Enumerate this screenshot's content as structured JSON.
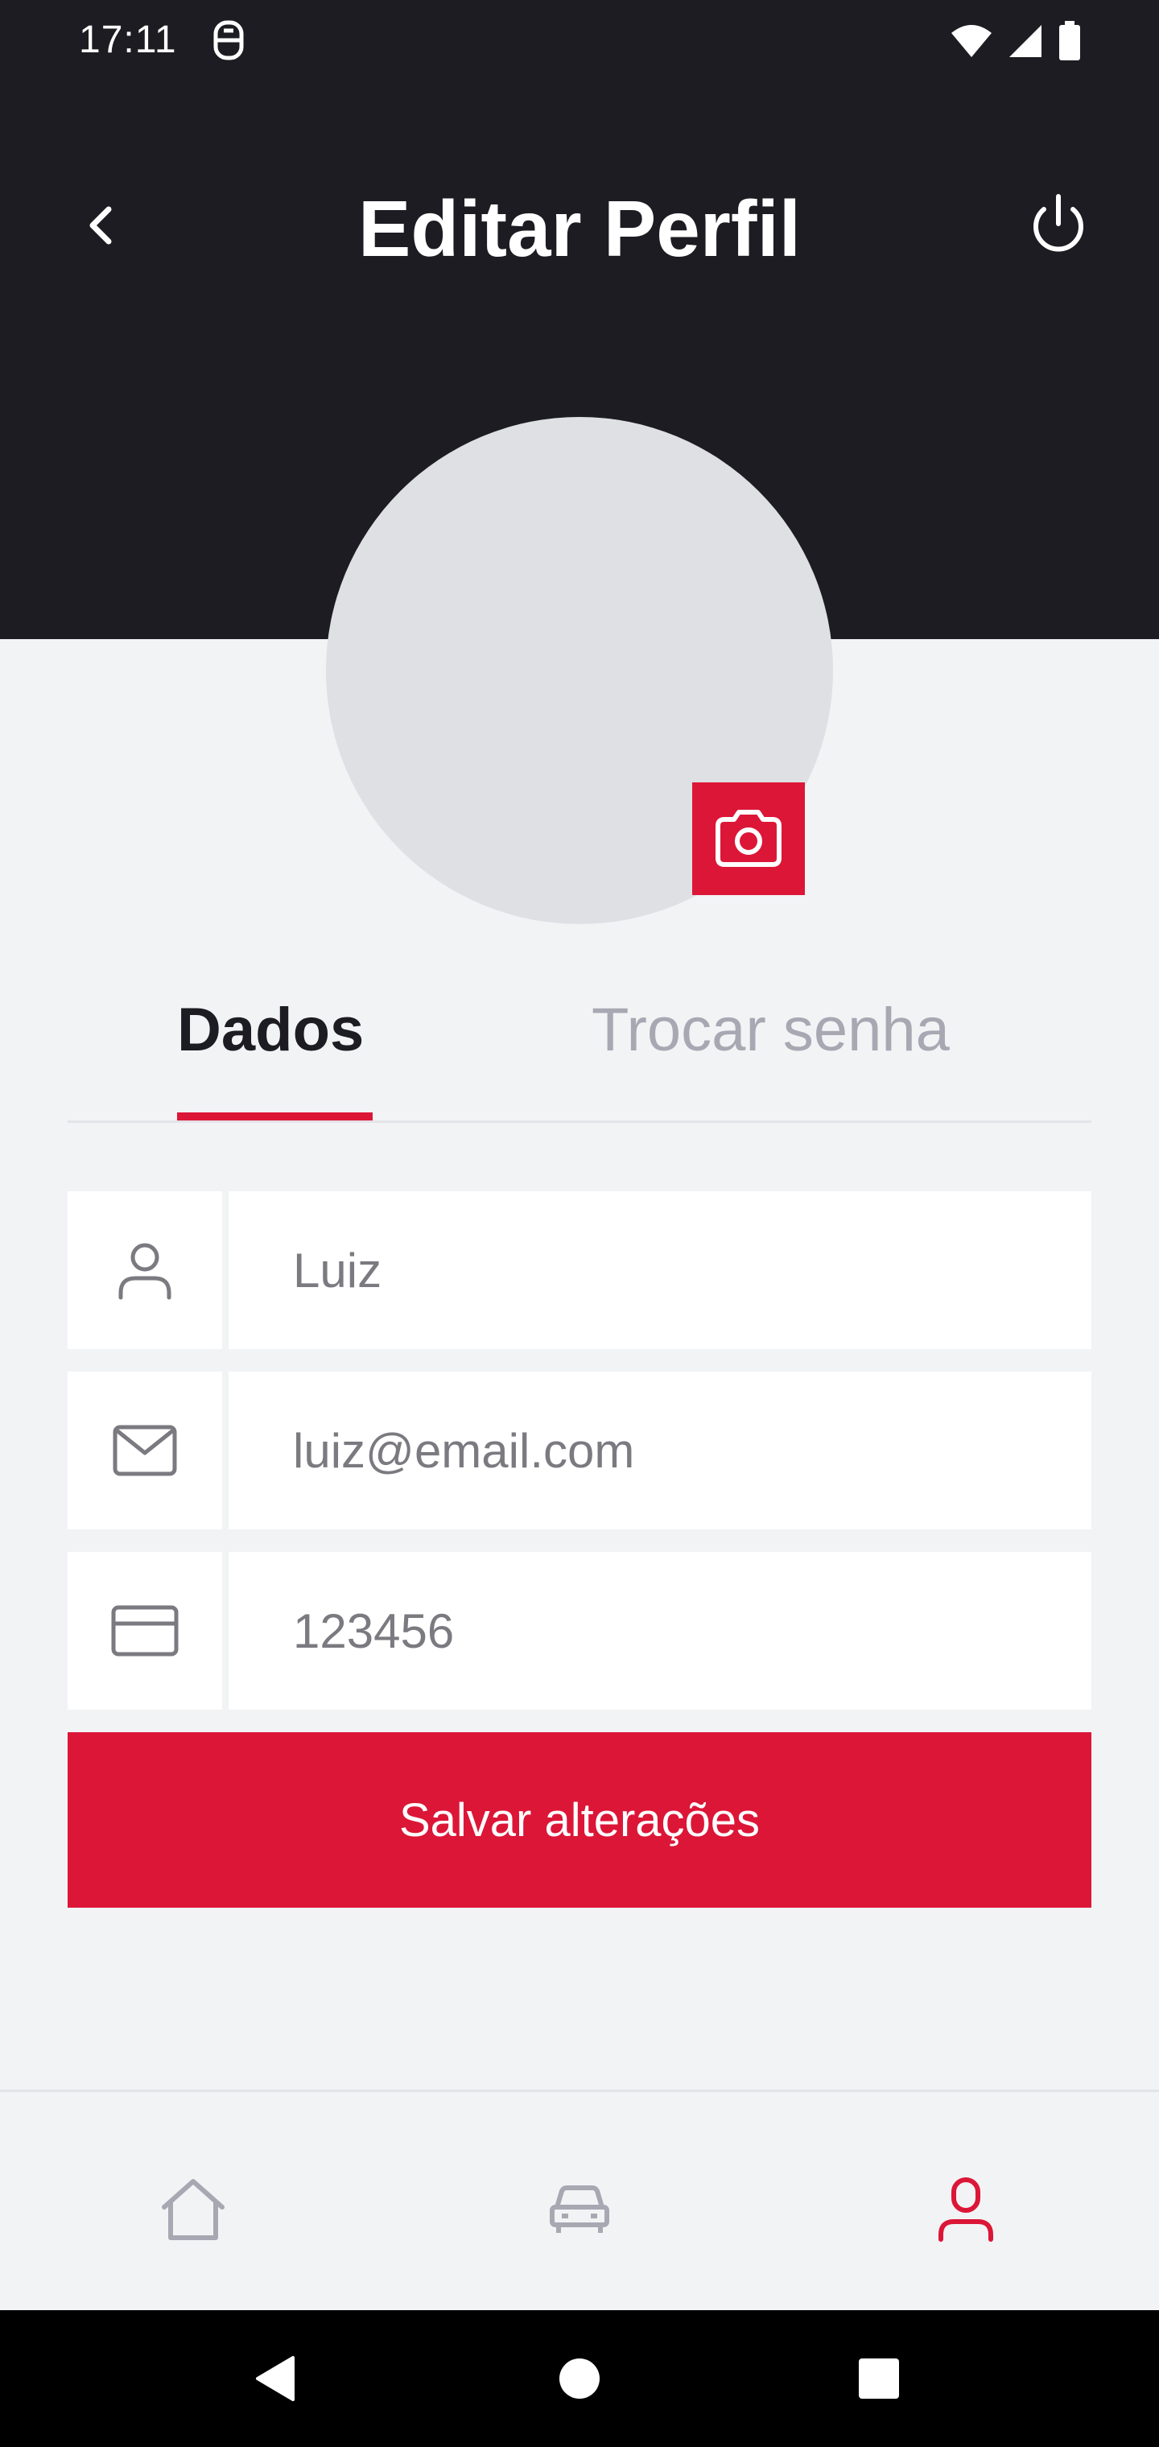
{
  "status_bar": {
    "time": "17:11",
    "icons": [
      "app-notification-icon",
      "wifi-icon",
      "signal-icon",
      "battery-icon"
    ]
  },
  "header": {
    "title": "Editar Perfil",
    "back_icon": "chevron-left-icon",
    "logout_icon": "power-icon",
    "background": "#1C1C22"
  },
  "avatar": {
    "camera_icon": "camera-icon"
  },
  "tabs": [
    {
      "label": "Dados",
      "active": true
    },
    {
      "label": "Trocar senha",
      "active": false
    }
  ],
  "form": {
    "name": {
      "value": "Luiz",
      "icon": "user-icon"
    },
    "email": {
      "value": "luiz@email.com",
      "icon": "mail-icon"
    },
    "cnh": {
      "value": "123456",
      "icon": "credit-card-icon"
    }
  },
  "save_button": {
    "label": "Salvar alterações"
  },
  "bottom_nav": [
    {
      "icon": "home-icon",
      "active": false
    },
    {
      "icon": "car-icon",
      "active": false
    },
    {
      "icon": "user-icon",
      "active": true
    }
  ],
  "colors": {
    "accent": "#DC1637",
    "dark": "#1C1C22",
    "background": "#F2F3F5",
    "muted": "#A8A8B3"
  }
}
